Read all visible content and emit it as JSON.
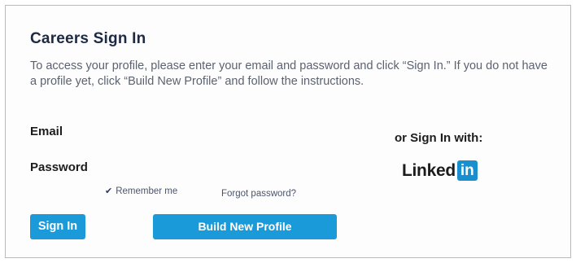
{
  "page": {
    "title": "Careers Sign In",
    "intro": "To access your profile, please enter your email and password and click “Sign In.” If you do not have a profile yet, click “Build New Profile” and follow the instructions."
  },
  "form": {
    "email_label": "Email",
    "email_value": "",
    "password_label": "Password",
    "password_value": "",
    "remember_label": "Remember me",
    "remember_checked": true,
    "forgot_label": "Forgot password?",
    "signin_label": "Sign In",
    "build_profile_label": "Build New Profile"
  },
  "social": {
    "heading": "or Sign In with:",
    "linkedin_word": "Linked",
    "linkedin_box": "in"
  },
  "colors": {
    "button_bg": "#1a9ad8",
    "linkedin_blue": "#1a8fd0",
    "title": "#1d2a44",
    "body_text": "#5b6270"
  },
  "icons": {
    "remember": "check-icon"
  }
}
